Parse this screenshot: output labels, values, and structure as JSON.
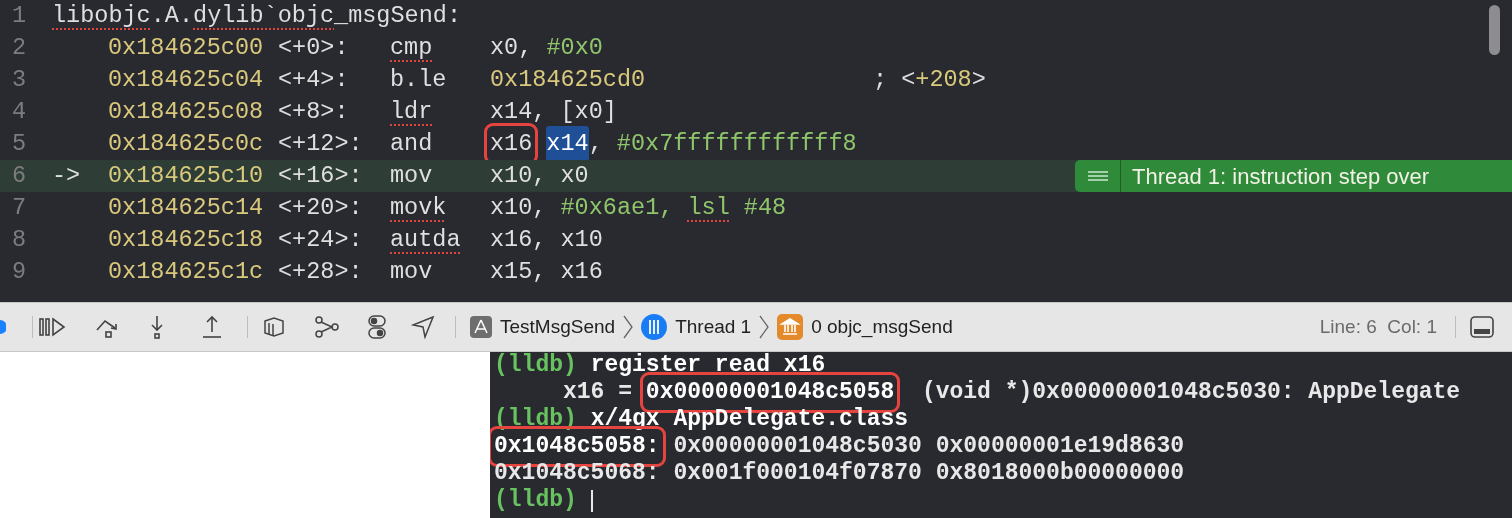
{
  "editor": {
    "lines": [
      {
        "number": "1",
        "current": false,
        "header": [
          {
            "text": "libobjc",
            "misspelled": true
          },
          {
            "text": ".A.",
            "misspelled": false
          },
          {
            "text": "dylib`objc",
            "misspelled": true
          },
          {
            "text": "_msgSend:",
            "misspelled": false
          }
        ]
      },
      {
        "number": "2",
        "current": false,
        "address": "0x184625c00",
        "offset": "<+0>:",
        "mnemonic": "cmp",
        "misspelled": true,
        "operands": [
          {
            "kind": "plain",
            "text": "x0, "
          },
          {
            "kind": "imm",
            "text": "#0x0"
          }
        ]
      },
      {
        "number": "3",
        "current": false,
        "address": "0x184625c04",
        "offset": "<+4>:",
        "mnemonic": "b.le",
        "misspelled": false,
        "operands": [
          {
            "kind": "addr",
            "text": "0x184625cd0"
          }
        ],
        "comment": [
          {
            "kind": "plain",
            "text": "; <"
          },
          {
            "kind": "addr",
            "text": "+208"
          },
          {
            "kind": "plain",
            "text": ">"
          }
        ]
      },
      {
        "number": "4",
        "current": false,
        "address": "0x184625c08",
        "offset": "<+8>:",
        "mnemonic": "ldr",
        "misspelled": true,
        "operands": [
          {
            "kind": "plain",
            "text": "x14, [x0]"
          }
        ]
      },
      {
        "number": "5",
        "current": false,
        "address": "0x184625c0c",
        "offset": "<+12>:",
        "mnemonic": "and",
        "misspelled": false,
        "operands": [
          {
            "kind": "boxed",
            "text": "x16"
          },
          {
            "kind": "selected",
            "text": "x14"
          },
          {
            "kind": "plain",
            "text": ", "
          },
          {
            "kind": "imm",
            "text": "#0x7ffffffffffff8"
          }
        ]
      },
      {
        "number": "6",
        "current": true,
        "arrow": "->",
        "address": "0x184625c10",
        "offset": "<+16>:",
        "mnemonic": "mov",
        "misspelled": false,
        "operands": [
          {
            "kind": "plain",
            "text": "x10, x0"
          }
        ],
        "annotation": "Thread 1: instruction step over"
      },
      {
        "number": "7",
        "current": false,
        "address": "0x184625c14",
        "offset": "<+20>:",
        "mnemonic": "movk",
        "misspelled": true,
        "operands": [
          {
            "kind": "plain",
            "text": "x10, "
          },
          {
            "kind": "imm",
            "text": "#0x6ae1, "
          },
          {
            "kind": "imm_misspelled",
            "text": "lsl"
          },
          {
            "kind": "imm",
            "text": " #48"
          }
        ]
      },
      {
        "number": "8",
        "current": false,
        "address": "0x184625c18",
        "offset": "<+24>:",
        "mnemonic": "autda",
        "misspelled": true,
        "operands": [
          {
            "kind": "plain",
            "text": "x16, x10"
          }
        ]
      },
      {
        "number": "9",
        "current": false,
        "address": "0x184625c1c",
        "offset": "<+28>:",
        "mnemonic": "mov",
        "misspelled": false,
        "operands": [
          {
            "kind": "plain",
            "text": "x15, x16"
          }
        ]
      }
    ]
  },
  "debug_bar": {
    "breadcrumbs": [
      {
        "kind": "app",
        "label": "TestMsgSend"
      },
      {
        "kind": "thread",
        "label": "Thread 1"
      },
      {
        "kind": "frame",
        "label": "0 objc_msgSend"
      }
    ],
    "position": "Line: 6  Col: 1"
  },
  "console": {
    "lines": [
      [
        {
          "kind": "prompt",
          "text": "(lldb) "
        },
        {
          "kind": "command",
          "text": "register read x16"
        }
      ],
      [
        {
          "kind": "output",
          "text": "     x16 = "
        },
        {
          "kind": "boxed",
          "text": "0x00000001048c5058"
        },
        {
          "kind": "output",
          "text": "  (void *)0x00000001048c5030: AppDelegate"
        }
      ],
      [
        {
          "kind": "prompt",
          "text": "(lldb) "
        },
        {
          "kind": "command",
          "text": "x/4gx AppDelegate.class"
        }
      ],
      [
        {
          "kind": "boxed",
          "text": "0x1048c5058:"
        },
        {
          "kind": "output",
          "text": " 0x00000001048c5030 0x00000001e19d8630"
        }
      ],
      [
        {
          "kind": "output",
          "text": "0x1048c5068: 0x001f000104f07870 0x8018000b00000000"
        }
      ],
      [
        {
          "kind": "prompt",
          "text": "(lldb) "
        },
        {
          "kind": "cursor"
        }
      ]
    ]
  }
}
